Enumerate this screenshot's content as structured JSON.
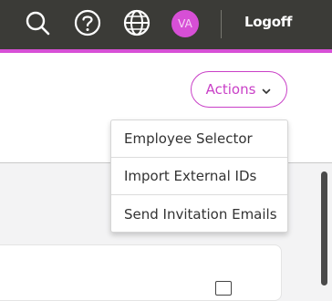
{
  "topbar": {
    "icons": [
      "search-icon",
      "help-icon",
      "globe-icon"
    ],
    "avatar_initials": "VA",
    "logoff_label": "Logoff",
    "accent_color": "#d74fd6"
  },
  "actions": {
    "button_label": "Actions",
    "menu_items": [
      {
        "label": "Employee Selector"
      },
      {
        "label": "Import External IDs"
      },
      {
        "label": "Send Invitation Emails"
      }
    ]
  }
}
